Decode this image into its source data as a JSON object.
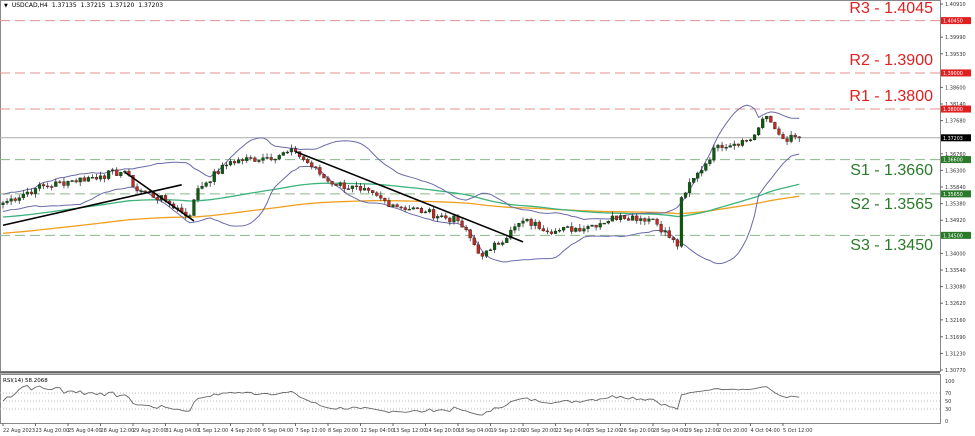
{
  "header": {
    "symbol": "USDCAD,H4",
    "open": "1.37135",
    "high": "1.37215",
    "low": "1.37120",
    "close": "1.37203"
  },
  "rsi": {
    "label": "RSI(14) 58.2068",
    "ticks": [
      "100",
      "70",
      "50",
      "30",
      "0"
    ]
  },
  "colors": {
    "bull": "#0b5e0b",
    "bear": "#c8281e",
    "bollinger": "#6a6aaa",
    "ma_green": "#3cb37a",
    "ma_orange": "#f0a020",
    "resistance": "#e02020",
    "support": "#2a7a2a",
    "current": "#000000"
  },
  "levels": [
    {
      "name": "R3",
      "label": "R3 - 1.4045",
      "value": 1.4045,
      "tag": "1.40450",
      "type": "resistance"
    },
    {
      "name": "R2",
      "label": "R2 - 1.3900",
      "value": 1.39,
      "tag": "1.39000",
      "type": "resistance"
    },
    {
      "name": "R1",
      "label": "R1 - 1.3800",
      "value": 1.38,
      "tag": "1.38000",
      "type": "resistance"
    },
    {
      "name": "S1",
      "label": "S1 - 1.3660",
      "value": 1.366,
      "tag": "1.36600",
      "type": "support"
    },
    {
      "name": "S2",
      "label": "S2 - 1.3565",
      "value": 1.3565,
      "tag": "1.35650",
      "type": "support"
    },
    {
      "name": "S3",
      "label": "S3 - 1.3450",
      "value": 1.345,
      "tag": "1.34500",
      "type": "support"
    }
  ],
  "current_price": {
    "value": 1.37203,
    "tag": "1.37203"
  },
  "chart_data": {
    "type": "candlestick",
    "timeframe": "H4",
    "ylim": [
      1.3077,
      1.4091
    ],
    "y_ticks": [
      "1.40910",
      "1.39990",
      "1.39530",
      "1.38600",
      "1.38140",
      "1.37680",
      "1.36760",
      "1.36300",
      "1.35840",
      "1.35380",
      "1.34920",
      "1.34000",
      "1.33540",
      "1.33080",
      "1.32620",
      "1.32160",
      "1.31690",
      "1.31230",
      "1.30770"
    ],
    "x_ticks": [
      {
        "label": "22 Aug 2023",
        "t": "2023-08-22 12:00"
      },
      {
        "label": "23 Aug 20:00",
        "t": "2023-08-23 20:00"
      },
      {
        "label": "25 Aug 04:00",
        "t": "2023-08-25 04:00"
      },
      {
        "label": "28 Aug 12:00",
        "t": "2023-08-28 12:00"
      },
      {
        "label": "29 Aug 20:00",
        "t": "2023-08-29 20:00"
      },
      {
        "label": "31 Aug 04:00",
        "t": "2023-08-31 04:00"
      },
      {
        "label": "1 Sep 12:00",
        "t": "2023-09-01 12:00"
      },
      {
        "label": "4 Sep 20:00",
        "t": "2023-09-04 20:00"
      },
      {
        "label": "6 Sep 04:00",
        "t": "2023-09-06 04:00"
      },
      {
        "label": "7 Sep 12:00",
        "t": "2023-09-07 12:00"
      },
      {
        "label": "8 Sep 20:00",
        "t": "2023-09-08 20:00"
      },
      {
        "label": "12 Sep 04:00",
        "t": "2023-09-12 04:00"
      },
      {
        "label": "13 Sep 12:00",
        "t": "2023-09-13 12:00"
      },
      {
        "label": "14 Sep 20:00",
        "t": "2023-09-14 20:00"
      },
      {
        "label": "18 Sep 04:00",
        "t": "2023-09-18 04:00"
      },
      {
        "label": "19 Sep 12:00",
        "t": "2023-09-19 12:00"
      },
      {
        "label": "20 Sep 20:00",
        "t": "2023-09-20 20:00"
      },
      {
        "label": "22 Sep 04:00",
        "t": "2023-09-22 04:00"
      },
      {
        "label": "25 Sep 12:00",
        "t": "2023-09-25 12:00"
      },
      {
        "label": "26 Sep 20:00",
        "t": "2023-09-26 20:00"
      },
      {
        "label": "28 Sep 04:00",
        "t": "2023-09-28 04:00"
      },
      {
        "label": "29 Sep 12:00",
        "t": "2023-09-29 12:00"
      },
      {
        "label": "2 Oct 20:00",
        "t": "2023-10-02 20:00"
      },
      {
        "label": "4 Oct 04:00",
        "t": "2023-10-04 04:00"
      },
      {
        "label": "5 Oct 12:00",
        "t": "2023-10-05 12:00"
      }
    ],
    "close_keypoints": [
      [
        "2023-08-22 12:00",
        1.354
      ],
      [
        "2023-08-23 20:00",
        1.358
      ],
      [
        "2023-08-25 04:00",
        1.36
      ],
      [
        "2023-08-28 12:00",
        1.3615
      ],
      [
        "2023-08-29 12:00",
        1.3628
      ],
      [
        "2023-08-29 20:00",
        1.3585
      ],
      [
        "2023-08-31 04:00",
        1.3545
      ],
      [
        "2023-09-01 04:00",
        1.3505
      ],
      [
        "2023-09-01 12:00",
        1.358
      ],
      [
        "2023-09-04 20:00",
        1.3655
      ],
      [
        "2023-09-06 04:00",
        1.3665
      ],
      [
        "2023-09-07 12:00",
        1.3682
      ],
      [
        "2023-09-08 20:00",
        1.36
      ],
      [
        "2023-09-12 04:00",
        1.3575
      ],
      [
        "2023-09-13 12:00",
        1.3535
      ],
      [
        "2023-09-14 20:00",
        1.3515
      ],
      [
        "2023-09-18 04:00",
        1.349
      ],
      [
        "2023-09-19 04:00",
        1.3392
      ],
      [
        "2023-09-19 12:00",
        1.341
      ],
      [
        "2023-09-20 20:00",
        1.349
      ],
      [
        "2023-09-22 04:00",
        1.3462
      ],
      [
        "2023-09-25 12:00",
        1.3475
      ],
      [
        "2023-09-26 20:00",
        1.3505
      ],
      [
        "2023-09-28 04:00",
        1.3495
      ],
      [
        "2023-09-29 04:00",
        1.342
      ],
      [
        "2023-09-29 08:00",
        1.3555
      ],
      [
        "2023-10-02 20:00",
        1.37
      ],
      [
        "2023-10-04 04:00",
        1.3715
      ],
      [
        "2023-10-04 20:00",
        1.378
      ],
      [
        "2023-10-05 04:00",
        1.3745
      ],
      [
        "2023-10-05 12:00",
        1.3718
      ],
      [
        "2023-10-06 04:00",
        1.372
      ]
    ],
    "moving_averages": [
      {
        "color": "green",
        "start": 1.35
      },
      {
        "color": "orange",
        "start": 1.3455
      }
    ],
    "trend_lines": [
      [
        [
          "2023-08-22 12:00",
          1.3478
        ],
        [
          "2023-08-31 20:00",
          1.359
        ]
      ],
      [
        [
          "2023-08-29 12:00",
          1.3625
        ],
        [
          "2023-09-01 08:00",
          1.349
        ]
      ],
      [
        [
          "2023-09-07 12:00",
          1.3682
        ],
        [
          "2023-09-20 20:00",
          1.3432
        ]
      ]
    ]
  }
}
